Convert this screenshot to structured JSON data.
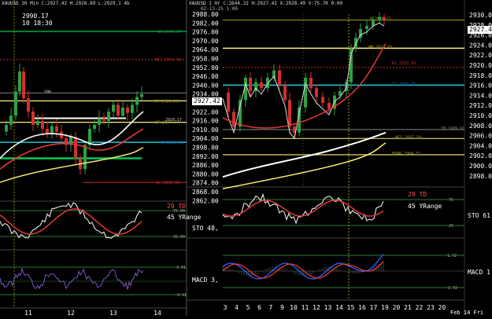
{
  "left_panel": {
    "header": "XAUUSD 30 Min C:2927.42 H:2928.89 L:2929.1 4b",
    "crosshair_price": "2990.17",
    "crosshair_time": "10 18:30",
    "price_marker": "2927.42",
    "level_tags": [
      {
        "text": "WM 2975.37",
        "color": "#2e7d32"
      },
      {
        "text": "WE2 2954.34",
        "color": "#c62828"
      },
      {
        "text": "506",
        "color": "#cccccc"
      },
      {
        "text": "WM 2923.03",
        "color": "#9e9d24"
      },
      {
        "text": "WF 2907.79",
        "color": "#9e9d24"
      },
      {
        "text": "2910.17",
        "color": "#cccccc"
      },
      {
        "text": "WO 2892.31",
        "color": "#1565c0"
      },
      {
        "text": "SL 2862.00",
        "color": "#c62828"
      }
    ],
    "x_ticks": [
      "11",
      "12",
      "13",
      "14"
    ],
    "sto": {
      "td_label": "29 TD",
      "range_label": "45 YRange",
      "name": "STO 48,",
      "levels": [
        "75.00",
        "25.00"
      ]
    },
    "macd": {
      "name": "MACD 3,",
      "levels": [
        "3.91",
        "-3.91"
      ]
    }
  },
  "right_panel": {
    "header": "XAUUSD 1 Hr C:2644.32 H:2927.42 X:2928.49 V:75.7K 0:00",
    "crosshair_time": "02-13-25 1:00",
    "price_marker": "2927.42",
    "y_axis": [
      "2988.00",
      "2982.00",
      "2976.00",
      "2970.00",
      "2964.00",
      "2958.00",
      "2952.00",
      "2946.00",
      "2940.00",
      "2934.00",
      "2928.00",
      "2922.00",
      "2916.00",
      "2910.00",
      "2904.00",
      "2898.00",
      "2892.00",
      "2886.00",
      "2880.00",
      "2874.00",
      "2868.00",
      "2862.00"
    ],
    "level_tags": [
      {
        "text": "H 2929.15",
        "color": "#9e9d24"
      },
      {
        "text": "WM 2923.83",
        "color": "#9e9d24"
      },
      {
        "text": "R1 2923.93",
        "color": "#c62828"
      },
      {
        "text": "S1 2916.75",
        "color": "#1565c0"
      },
      {
        "text": "7H 2909.91",
        "color": "#888888"
      },
      {
        "text": "WF1 2897.59",
        "color": "#9e9d24"
      },
      {
        "text": "BORR 2904.32",
        "color": "#9e9d24"
      }
    ],
    "x_ticks": [
      "3",
      "4",
      "5",
      "6",
      "7",
      "9",
      "10",
      "11",
      "12",
      "13",
      "14",
      "15",
      "16",
      "17",
      "19",
      "20",
      "21",
      "22",
      "23",
      "20"
    ],
    "x_date": "Feb 14 Fri",
    "sto": {
      "td_label": "29 TD",
      "range_label": "45 YRange",
      "name": "STO 61",
      "levels": [
        "75",
        "25"
      ]
    },
    "macd": {
      "name": "MACD 1",
      "levels": [
        "1.72",
        "-1.72"
      ]
    }
  },
  "far_axis": {
    "labels": [
      "2930.00",
      "2928.00",
      "2926.00",
      "2924.00",
      "2922.00",
      "2920.00",
      "2918.00",
      "2916.00",
      "2914.00",
      "2912.00",
      "2910.00",
      "2908.00",
      "2906.00",
      "2904.00",
      "2902.00",
      "2900.00",
      "2898.00"
    ],
    "price_marker": "2927.42"
  },
  "colors": {
    "up": "#2ea043",
    "down": "#d32f2f",
    "ma_white": "#ffffff",
    "ma_red": "#e53935",
    "ma_yellow": "#fff176",
    "cyan_level": "#26c6da",
    "green_level": "#00c853",
    "sto_line": "#ffffff",
    "sto_signal": "#e53935",
    "macd_blue": "#2962ff",
    "macd_red": "#e53935",
    "td_label": "#ff5252"
  }
}
